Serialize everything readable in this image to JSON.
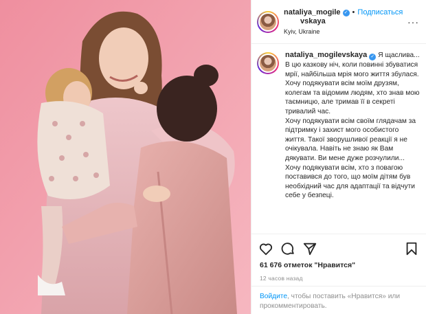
{
  "post": {
    "author": {
      "username_line1": "nataliya_mogile",
      "username_line2": "vskaya",
      "location": "Kyiv, Ukraine"
    },
    "follow_label": "Подписаться",
    "dot": "•",
    "more_label": "···",
    "caption": {
      "username": "nataliya_mogilevskaya",
      "text": "Я щаслива... В цю казкову ніч, коли повинні збуватися мрії, найбільша мрія мого життя збулася.\nХочу подякувати всім моїм друзям, колегам та відомим людям, хто знав мою таємницю, але тримав її в секреті тривалий час.\nХочу подякувати всім своїм глядачам за підтримку і захист мого особистого життя. Такої зворушливої реакції я не очікувала. Навіть не знаю як Вам дякувати. Ви мене дуже розчулили...\nХочу подякувати всім, хто з повагою поставився до того, що моїм дітям був необхідний час для адаптації та відчути себе у безпеці."
    },
    "likes": "61 676 отметок \"Нравится\"",
    "time_ago": "12 часов назад",
    "footer": {
      "login_link": "Войдите",
      "rest": ", чтобы поставить «Нравится» или прокомментировать."
    }
  },
  "icons": {
    "verified": "verified-badge-icon",
    "like": "heart-icon",
    "comment": "comment-icon",
    "share": "share-icon",
    "save": "bookmark-icon"
  },
  "colors": {
    "accent": "#0095f6",
    "verified": "#3897f0",
    "photo_background": "#f2a3b0",
    "muted_text": "#8e8e8e"
  }
}
